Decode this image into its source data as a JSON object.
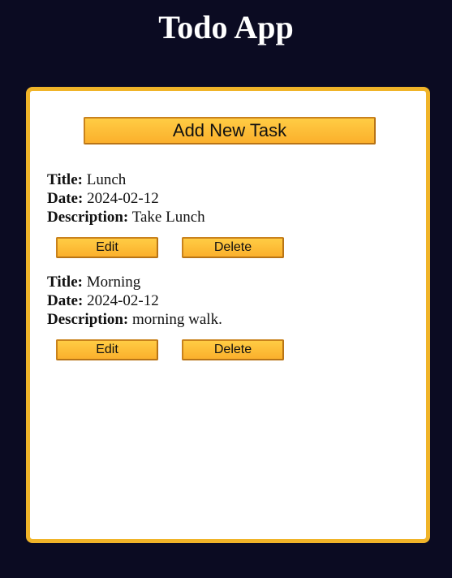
{
  "header": {
    "title": "Todo App"
  },
  "toolbar": {
    "add_label": "Add New Task"
  },
  "labels": {
    "title": "Title:",
    "date": "Date:",
    "description": "Description:"
  },
  "tasks": [
    {
      "title": "Lunch",
      "date": "2024-02-12",
      "description": "Take Lunch",
      "edit_label": "Edit",
      "delete_label": "Delete"
    },
    {
      "title": "Morning",
      "date": "2024-02-12",
      "description": "morning walk.",
      "edit_label": "Edit",
      "delete_label": "Delete"
    }
  ],
  "colors": {
    "page_background": "#0b0b22",
    "card_border": "#f0b429",
    "button_fill": "#fbb02c",
    "title_text": "#ffffff"
  }
}
